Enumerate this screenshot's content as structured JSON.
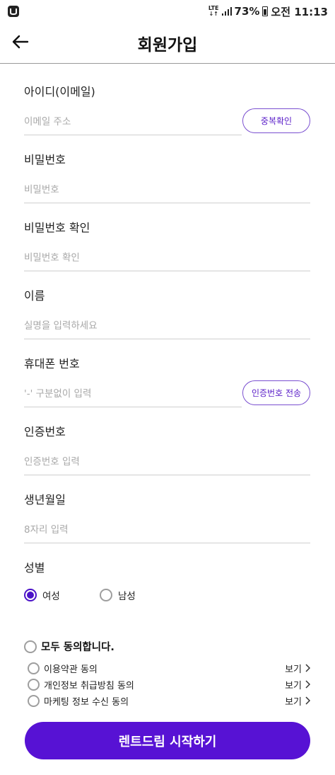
{
  "status_bar": {
    "network": "LTE",
    "battery": "73%",
    "time": "오전 11:13"
  },
  "header": {
    "title": "회원가입",
    "back_icon": "arrow-left-icon"
  },
  "form": {
    "email": {
      "label": "아이디(이메일)",
      "placeholder": "이메일 주소",
      "value": "",
      "button": "중복확인"
    },
    "password": {
      "label": "비밀번호",
      "placeholder": "비밀번호",
      "value": ""
    },
    "password_confirm": {
      "label": "비밀번호 확인",
      "placeholder": "비밀번호 확인",
      "value": ""
    },
    "name": {
      "label": "이름",
      "placeholder": "실명을 입력하세요",
      "value": ""
    },
    "phone": {
      "label": "휴대폰 번호",
      "placeholder": "'-' 구분없이 입력",
      "value": "",
      "button": "인증번호 전송"
    },
    "auth_code": {
      "label": "인증번호",
      "placeholder": "인증번호 입력",
      "value": ""
    },
    "birth": {
      "label": "생년월일",
      "placeholder": "8자리 입력",
      "value": ""
    },
    "gender": {
      "label": "성별",
      "options": [
        "여성",
        "남성"
      ],
      "selected": "여성"
    }
  },
  "agreements": {
    "all_label": "모두 동의합니다.",
    "view_label": "보기",
    "items": [
      {
        "label": "이용약관 동의"
      },
      {
        "label": "개인정보 취급방침 동의"
      },
      {
        "label": "마케팅 정보 수신 동의"
      }
    ]
  },
  "submit": {
    "label": "렌트드림 시작하기"
  },
  "colors": {
    "accent": "#5712d4",
    "border_gray": "#cfcfcf",
    "placeholder": "#a8a8a8"
  }
}
